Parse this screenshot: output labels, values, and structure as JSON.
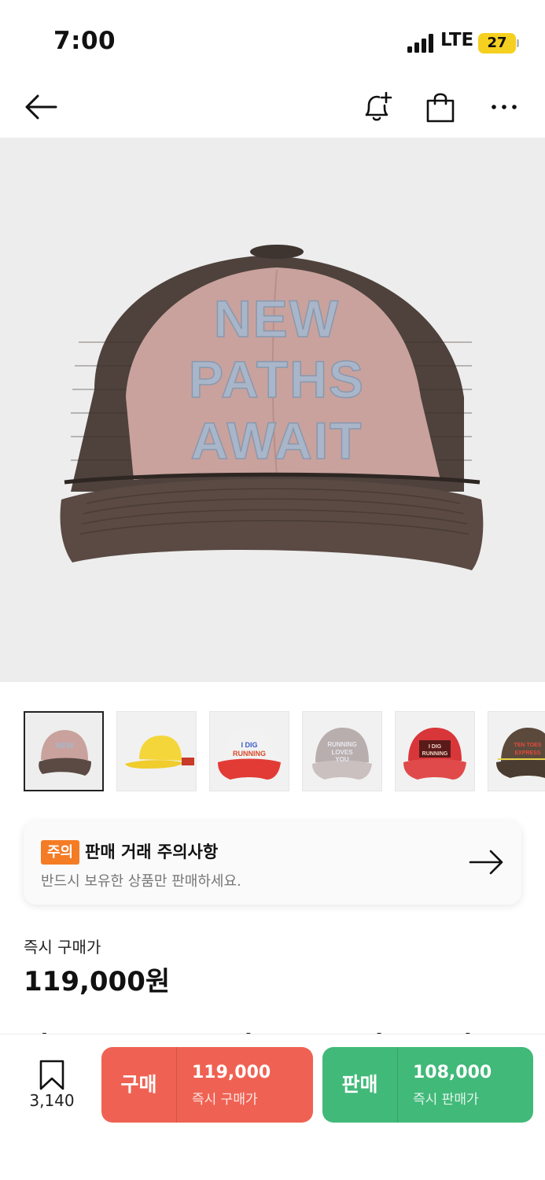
{
  "status_bar": {
    "time": "7:00",
    "network": "LTE",
    "battery": "27",
    "icons": [
      "signal-icon",
      "battery-icon"
    ]
  },
  "nav": {
    "icons": [
      "back-arrow-icon",
      "bell-plus-icon",
      "shopping-bag-icon",
      "more-icon"
    ]
  },
  "product": {
    "hero_icon": "cap-image",
    "thumbnails": [
      {
        "name": "brown-pink-cap",
        "selected": true
      },
      {
        "name": "yellow-cap",
        "selected": false
      },
      {
        "name": "white-red-cap",
        "selected": false
      },
      {
        "name": "grey-cap",
        "selected": false
      },
      {
        "name": "red-cap",
        "selected": false
      },
      {
        "name": "brown-cap",
        "selected": false
      }
    ],
    "title_peek": "Also Forever Words New Paths Await"
  },
  "notice": {
    "badge": "주의",
    "title": "판매 거래 주의사항",
    "subtitle": "반드시 보유한 상품만 판매하세요."
  },
  "price": {
    "label": "즉시 구매가",
    "value": "119,000원"
  },
  "bottom_bar": {
    "wishlist_count": "3,140",
    "buy": {
      "label": "구매",
      "amount": "119,000",
      "sub": "즉시 구매가"
    },
    "sell": {
      "label": "판매",
      "amount": "108,000",
      "sub": "즉시 판매가"
    }
  },
  "colors": {
    "buy": "#ef6253",
    "sell": "#41b979",
    "notice_badge": "#f47c25",
    "battery": "#f5d020"
  }
}
